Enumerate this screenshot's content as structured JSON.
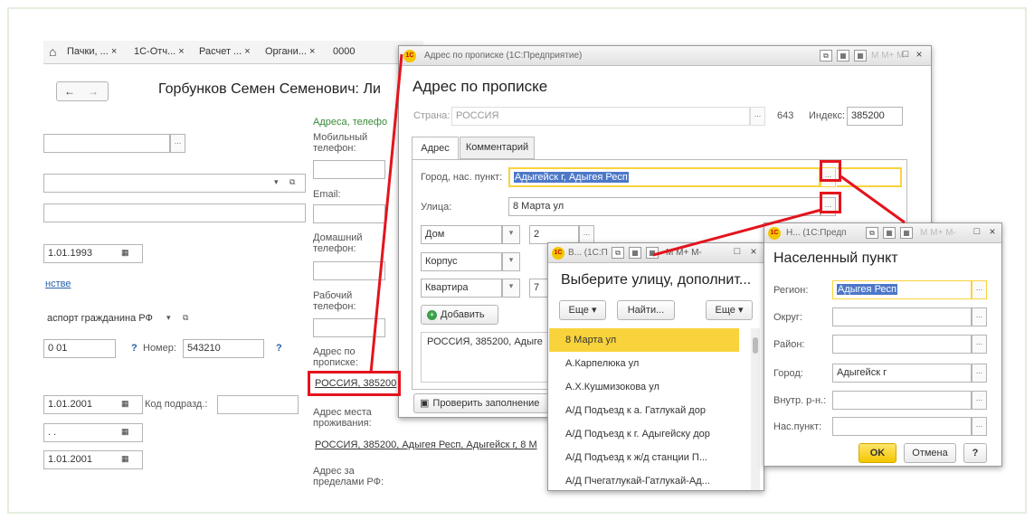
{
  "tabs": {
    "home": "⌂",
    "t1": "Пачки, ...",
    "t2": "1С-Отч...",
    "t3": "Расчет ...",
    "t4": "Органи...",
    "t5": "0000",
    "close": "×"
  },
  "main": {
    "title": "Горбунков Семен Семенович: Ли",
    "nav_back": "←",
    "nav_fwd": "→",
    "date1": "1.01.1993",
    "link_text": "нстве",
    "doc_type": "аспорт гражданина РФ",
    "series": "0 01",
    "number_label": "Номер:",
    "number_value": "543210",
    "q": "?",
    "date2": "1.01.2001",
    "code_label": "Код подразд.:",
    "date3": ". .",
    "date4": "1.01.2001",
    "contacts_header": "Адреса, телефо",
    "mobile_label": "Мобильный телефон:",
    "email_label": "Email:",
    "home_phone_label": "Домашний телефон:",
    "work_phone_label": "Рабочий телефон:",
    "reg_addr_label": "Адрес по пропиcке:",
    "reg_addr_value": "РОССИЯ, 385200",
    "res_addr_label": "Адрес места проживания:",
    "res_addr_value": "РОССИЯ, 385200, Адыгея Респ, Адыгейск г, 8 М",
    "foreign_addr_label": "Адрес за пределами РФ:"
  },
  "addr_dialog": {
    "titlebar": "Адрес по прописке  (1С:Предприятие)",
    "heading": "Адрес по прописке",
    "country_label": "Страна:",
    "country_value": "РОССИЯ",
    "country_code": "643",
    "index_label": "Индекс:",
    "index_value": "385200",
    "tab_address": "Адрес",
    "tab_comment": "Комментарий",
    "city_label": "Город, нас. пункт:",
    "city_value": "Адыгейск г, Адыгея Респ",
    "street_label": "Улица:",
    "street_value": "8 Марта ул",
    "house_type": "Дом",
    "house_value": "2",
    "block_type": "Корпус",
    "flat_type": "Квартира",
    "flat_value": "7",
    "add_button": "Добавить",
    "full_text": "РОССИЯ, 385200, Адыге",
    "check_button": "Проверить заполнение"
  },
  "street_dialog": {
    "titlebar": "В... (1С:П",
    "heading": "Выберите улицу, дополнит...",
    "more1": "Еще ▾",
    "find": "Найти...",
    "more2": "Еще ▾",
    "items": [
      "8 Марта ул",
      "А.Карпелюка ул",
      "А.Х.Кушмизокова ул",
      "А/Д Подъезд к а. Гатлукай дор",
      "А/Д Подъезд к г. Адыгейску дор",
      "А/Д Подъезд к ж/д станции П...",
      "А/Д Пчегатлукай-Гатлукай-Ад..."
    ]
  },
  "locality_dialog": {
    "titlebar": "Н...  (1С:Предп",
    "heading": "Населенный пункт",
    "region_label": "Регион:",
    "region_value": "Адыгея Респ",
    "district_label": "Округ:",
    "area_label": "Район:",
    "city_label": "Город:",
    "city_value": "Адыгейск г",
    "inner_label": "Внутр. р-н.:",
    "locality_label": "Нас.пункт:",
    "ok": "OK",
    "cancel": "Отмена",
    "help": "?"
  },
  "titlebar_buttons": {
    "m": "M",
    "mplus": "M+",
    "mminus": "M-",
    "restore": "□",
    "close": "×"
  },
  "colors": {
    "highlight": "#f9d33c",
    "selection": "#4d78c8",
    "red_annotation": "#e3141d",
    "ok_button": "#f2c600"
  }
}
